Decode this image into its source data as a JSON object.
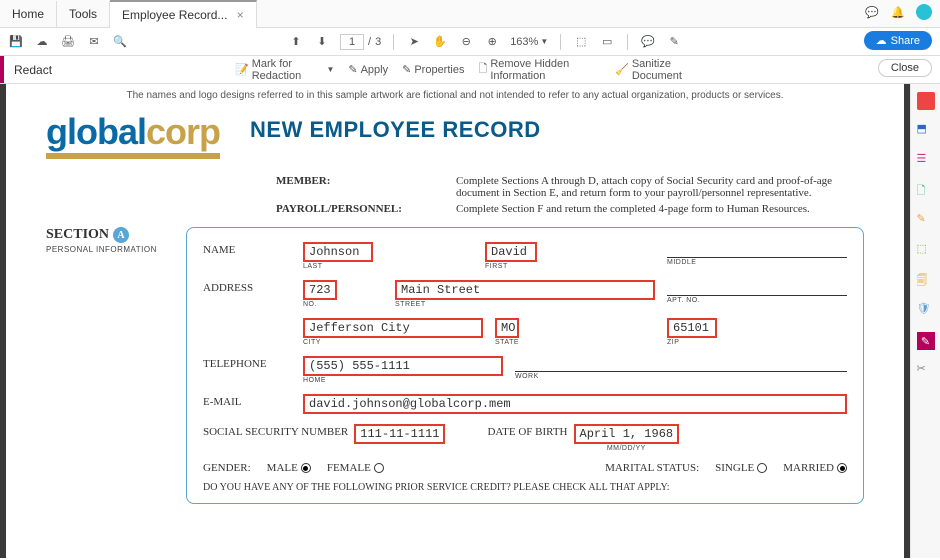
{
  "tabs": {
    "home": "Home",
    "tools": "Tools",
    "doc": "Employee Record..."
  },
  "toolbar": {
    "page_current": "1",
    "page_total": "3",
    "page_sep": "/",
    "zoom": "163%",
    "share": "Share"
  },
  "redact": {
    "title": "Redact",
    "mark": "Mark for Redaction",
    "apply": "Apply",
    "properties": "Properties",
    "remove_hidden": "Remove Hidden Information",
    "sanitize": "Sanitize Document",
    "close": "Close"
  },
  "doc": {
    "disclaimer": "The names and logo designs referred to in this sample artwork are fictional and not intended to refer to any actual organization, products or services.",
    "logo_a": "global",
    "logo_b": "corp",
    "title": "NEW EMPLOYEE RECORD",
    "member_label": "MEMBER:",
    "member_text": "Complete Sections A through D, attach copy of Social Security card and proof-of-age document in Section E, and return form to your payroll/personnel representative.",
    "payroll_label": "PAYROLL/PERSONNEL:",
    "payroll_text": "Complete Section F and return the completed 4-page form to Human Resources.",
    "section": "SECTION",
    "section_letter": "A",
    "section_sub": "PERSONAL INFORMATION",
    "name_label": "NAME",
    "name_last": "Johnson",
    "name_last_sub": "LAST",
    "name_first": "David",
    "name_first_sub": "FIRST",
    "name_middle_sub": "MIDDLE",
    "address_label": "ADDRESS",
    "addr_no": "723",
    "addr_no_sub": "NO.",
    "addr_street": "Main Street",
    "addr_street_sub": "STREET",
    "addr_apt_sub": "APT. NO.",
    "addr_city": "Jefferson City",
    "addr_city_sub": "CITY",
    "addr_state": "MO",
    "addr_state_sub": "STATE",
    "addr_zip": "65101",
    "addr_zip_sub": "ZIP",
    "tel_label": "TELEPHONE",
    "tel_home": "(555) 555-1111",
    "tel_home_sub": "HOME",
    "tel_work_sub": "WORK",
    "email_label": "E-MAIL",
    "email": "david.johnson@globalcorp.mem",
    "ssn_label": "SOCIAL SECURITY NUMBER",
    "ssn": "111-11-1111",
    "dob_label": "DATE OF BIRTH",
    "dob": "April 1, 1968",
    "dob_sub": "MM/DD/YY",
    "gender_label": "GENDER:",
    "male": "MALE",
    "female": "FEMALE",
    "marital_label": "MARITAL STATUS:",
    "single": "SINGLE",
    "married": "MARRIED",
    "prior_service": "DO YOU HAVE ANY OF THE FOLLOWING PRIOR SERVICE CREDIT? PLEASE CHECK ALL THAT APPLY:"
  }
}
